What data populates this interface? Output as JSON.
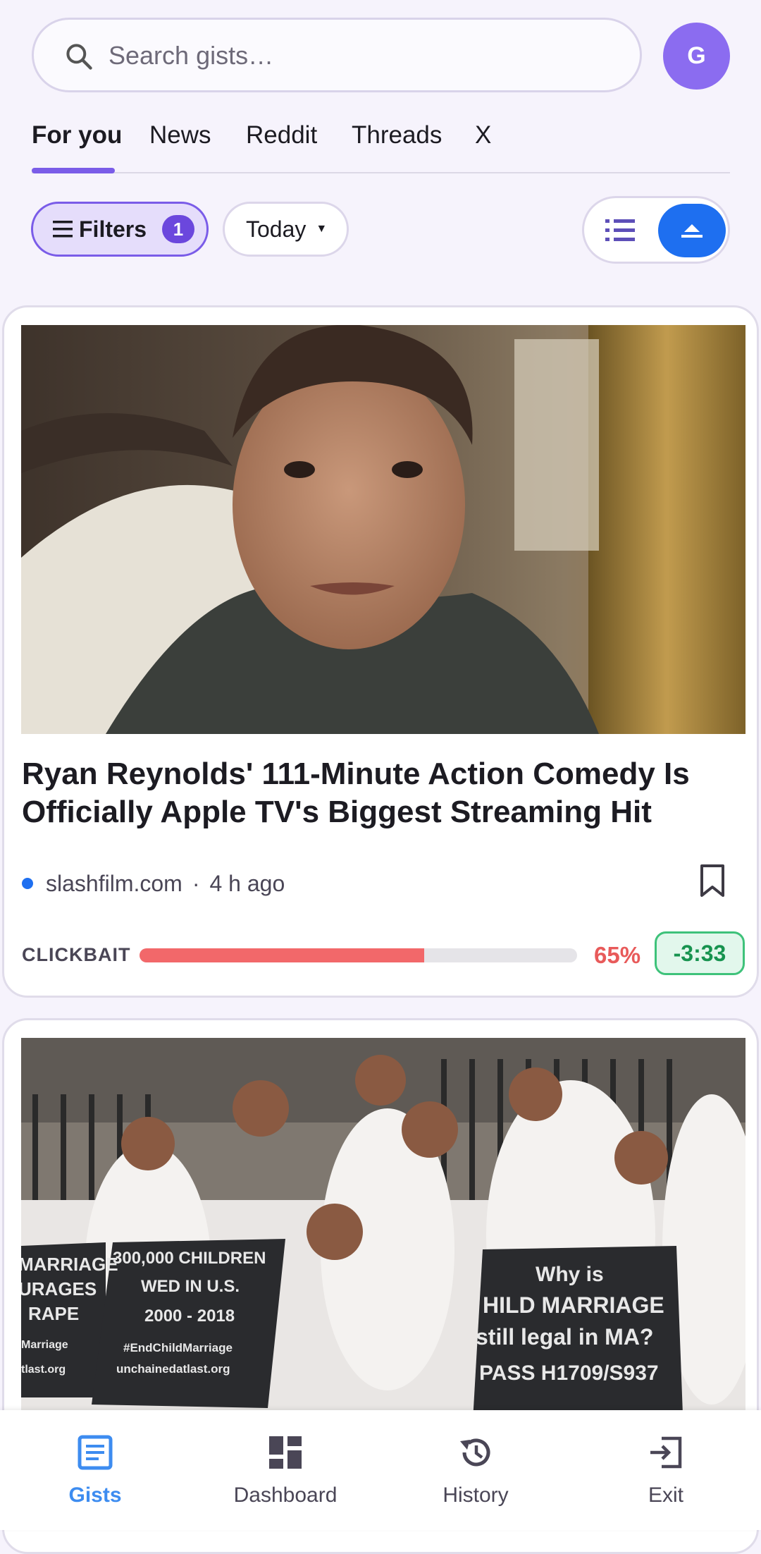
{
  "search": {
    "placeholder": "Search gists…",
    "value": ""
  },
  "avatar": {
    "initial": "G"
  },
  "tabs": [
    {
      "label": "For you",
      "active": true
    },
    {
      "label": "News",
      "active": false
    },
    {
      "label": "Reddit",
      "active": false
    },
    {
      "label": "Threads",
      "active": false
    },
    {
      "label": "X",
      "active": false
    }
  ],
  "filters": {
    "label": "Filters",
    "count": "1",
    "date": "Today"
  },
  "view_toggle": {
    "options": [
      "list-view-icon",
      "card-view-icon"
    ],
    "selected": "card-view-icon"
  },
  "articles": [
    {
      "title": "Ryan Reynolds' 111-Minute Action Comedy Is Officially Apple TV's Biggest Streaming Hit",
      "source": "slashfilm.com",
      "separator": "·",
      "time": "4 h ago",
      "clickbait_label": "CLICKBAIT",
      "clickbait_percent": 65,
      "clickbait_percent_text": "65%",
      "time_delta": "-3:33"
    },
    {
      "image_signs": {
        "sign_left": [
          "MARRIAGE",
          "URAGES",
          "RAPE",
          "Marriage",
          "tlast.org"
        ],
        "sign_middle": [
          "300,000 CHILDREN",
          "WED IN U.S.",
          "2000 - 2018",
          "#EndChildMarriage",
          "unchainedatlast.org"
        ],
        "sign_right": [
          "Why is",
          "HILD MARRIAGE",
          "still legal in MA?",
          "PASS H1709/S937"
        ]
      }
    }
  ],
  "bottom_nav": [
    {
      "label": "Gists",
      "icon": "article-icon",
      "active": true
    },
    {
      "label": "Dashboard",
      "icon": "dashboard-icon",
      "active": false
    },
    {
      "label": "History",
      "icon": "history-icon",
      "active": false
    },
    {
      "label": "Exit",
      "icon": "exit-icon",
      "active": false
    }
  ],
  "colors": {
    "accent": "#7a5ce8",
    "primary_blue": "#1e6ff0",
    "clickbait_red": "#f2686a",
    "time_green": "#17934f",
    "background": "#f6f3fc"
  }
}
